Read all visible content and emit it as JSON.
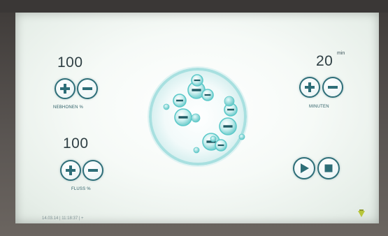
{
  "ionization": {
    "value": "100",
    "label": "NEBHONEN %"
  },
  "flow": {
    "value": "100",
    "label": "FLUSS %"
  },
  "duration": {
    "value": "20",
    "unit": "min",
    "label": "MINUTEN"
  },
  "status": {
    "datetime": "14.03.14 | 11:18:37 | +"
  },
  "icons": {
    "increase": "plus-icon",
    "decrease": "minus-icon",
    "play": "play-icon",
    "stop": "stop-icon",
    "ion_graphic": "negative-ions-icon",
    "indicator": "status-lamp-icon"
  },
  "colors": {
    "accent": "#2e6e78",
    "ion": "#5cc9c9",
    "text": "#2f3f44",
    "indicator": "#b8c63a"
  }
}
